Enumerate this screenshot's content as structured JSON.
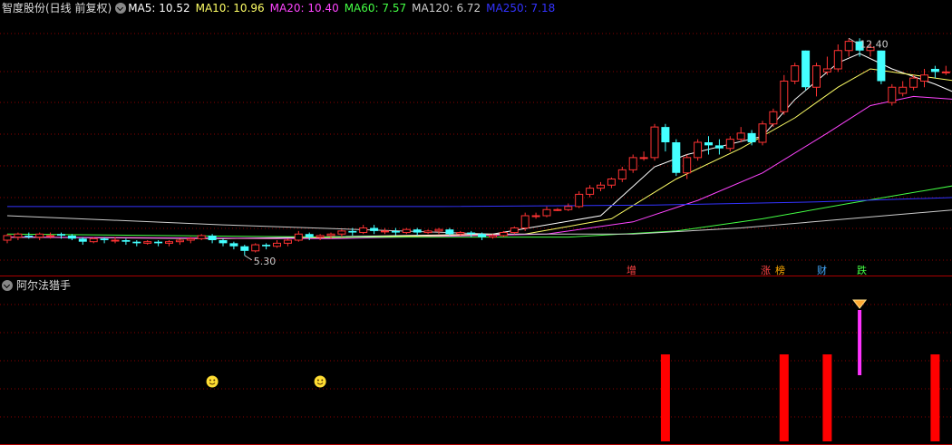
{
  "header": {
    "stock": "智度股份(日线 前复权)",
    "ma_labels": [
      {
        "text": "MA5: 10.52",
        "color": "#ffffff"
      },
      {
        "text": "MA10: 10.96",
        "color": "#ffff66"
      },
      {
        "text": "MA20: 10.40",
        "color": "#ff44ff"
      },
      {
        "text": "MA60: 7.57",
        "color": "#44ff44"
      },
      {
        "text": "MA120: 6.72",
        "color": "#cccccc"
      },
      {
        "text": "MA250: 7.18",
        "color": "#3333ff"
      }
    ]
  },
  "sub_panel": {
    "title": "阿尔法猎手"
  },
  "annotations": {
    "high_label": "12.40",
    "low_label": "5.30",
    "event_tags": [
      {
        "text": "增",
        "color": "#ff4444"
      },
      {
        "text": "涨",
        "color": "#ff4444"
      },
      {
        "text": "榜",
        "color": "#ffaa00"
      },
      {
        "text": "财",
        "color": "#44aaff"
      },
      {
        "text": "跌",
        "color": "#44ff44"
      }
    ]
  },
  "colors": {
    "up": "#ff3333",
    "down": "#44ffff",
    "grid": "#8b0000",
    "signal_bar": "#ff0000",
    "signal_magenta": "#ff33ff",
    "smiley": "#ffdd33"
  },
  "chart_data": {
    "type": "candlestick",
    "y_range": [
      5.0,
      13.0
    ],
    "candles": [
      [
        5.8,
        5.95,
        5.7,
        6.0
      ],
      [
        5.9,
        6.0,
        5.8,
        6.05
      ],
      [
        5.95,
        5.9,
        5.85,
        6.05
      ],
      [
        5.9,
        6.0,
        5.8,
        6.05
      ],
      [
        5.95,
        5.95,
        5.85,
        6.05
      ],
      [
        6.0,
        5.95,
        5.85,
        6.05
      ],
      [
        5.95,
        5.85,
        5.8,
        6.0
      ],
      [
        5.85,
        5.75,
        5.65,
        5.9
      ],
      [
        5.75,
        5.85,
        5.7,
        5.9
      ],
      [
        5.85,
        5.8,
        5.7,
        5.9
      ],
      [
        5.8,
        5.8,
        5.7,
        5.9
      ],
      [
        5.8,
        5.75,
        5.65,
        5.85
      ],
      [
        5.75,
        5.7,
        5.6,
        5.8
      ],
      [
        5.7,
        5.75,
        5.65,
        5.8
      ],
      [
        5.75,
        5.7,
        5.6,
        5.8
      ],
      [
        5.7,
        5.75,
        5.6,
        5.8
      ],
      [
        5.75,
        5.8,
        5.65,
        5.85
      ],
      [
        5.8,
        5.85,
        5.7,
        5.9
      ],
      [
        5.85,
        5.95,
        5.8,
        6.0
      ],
      [
        5.95,
        5.8,
        5.7,
        6.0
      ],
      [
        5.8,
        5.7,
        5.6,
        5.85
      ],
      [
        5.7,
        5.6,
        5.5,
        5.75
      ],
      [
        5.6,
        5.45,
        5.3,
        5.65
      ],
      [
        5.45,
        5.65,
        5.4,
        5.7
      ],
      [
        5.65,
        5.6,
        5.5,
        5.7
      ],
      [
        5.6,
        5.7,
        5.55,
        5.8
      ],
      [
        5.7,
        5.8,
        5.6,
        5.85
      ],
      [
        5.8,
        6.0,
        5.75,
        6.1
      ],
      [
        6.0,
        5.9,
        5.8,
        6.05
      ],
      [
        5.9,
        5.95,
        5.8,
        6.0
      ],
      [
        5.95,
        6.0,
        5.85,
        6.05
      ],
      [
        6.0,
        6.1,
        5.9,
        6.15
      ],
      [
        6.1,
        6.05,
        5.95,
        6.2
      ],
      [
        6.05,
        6.2,
        6.0,
        6.3
      ],
      [
        6.2,
        6.1,
        6.0,
        6.3
      ],
      [
        6.1,
        6.1,
        6.0,
        6.2
      ],
      [
        6.1,
        6.05,
        5.95,
        6.2
      ],
      [
        6.05,
        6.15,
        6.0,
        6.2
      ],
      [
        6.15,
        6.05,
        5.95,
        6.2
      ],
      [
        6.05,
        6.1,
        6.0,
        6.15
      ],
      [
        6.1,
        6.15,
        6.0,
        6.2
      ],
      [
        6.15,
        6.0,
        5.95,
        6.2
      ],
      [
        6.0,
        6.05,
        5.95,
        6.1
      ],
      [
        6.05,
        6.0,
        5.9,
        6.1
      ],
      [
        6.0,
        5.9,
        5.8,
        6.05
      ],
      [
        5.9,
        5.95,
        5.85,
        6.0
      ],
      [
        5.95,
        6.05,
        5.9,
        6.1
      ],
      [
        6.05,
        6.2,
        6.0,
        6.25
      ],
      [
        6.2,
        6.6,
        6.1,
        6.7
      ],
      [
        6.6,
        6.6,
        6.5,
        6.7
      ],
      [
        6.6,
        6.8,
        6.55,
        6.9
      ],
      [
        6.8,
        6.8,
        6.75,
        6.85
      ],
      [
        6.8,
        6.9,
        6.75,
        7.0
      ],
      [
        6.9,
        7.3,
        6.85,
        7.4
      ],
      [
        7.3,
        7.5,
        7.2,
        7.6
      ],
      [
        7.5,
        7.6,
        7.4,
        7.7
      ],
      [
        7.6,
        7.8,
        7.5,
        7.85
      ],
      [
        7.8,
        8.1,
        7.7,
        8.2
      ],
      [
        8.1,
        8.5,
        8.0,
        8.6
      ],
      [
        8.5,
        8.5,
        8.4,
        8.7
      ],
      [
        8.5,
        9.5,
        8.4,
        9.6
      ],
      [
        9.5,
        9.0,
        8.7,
        9.6
      ],
      [
        9.0,
        8.0,
        7.9,
        9.1
      ],
      [
        8.0,
        8.5,
        7.8,
        8.6
      ],
      [
        8.5,
        9.0,
        8.4,
        9.1
      ],
      [
        9.0,
        8.9,
        8.6,
        9.2
      ],
      [
        8.9,
        8.8,
        8.6,
        9.1
      ],
      [
        8.8,
        9.1,
        8.7,
        9.2
      ],
      [
        9.1,
        9.3,
        9.0,
        9.5
      ],
      [
        9.3,
        9.0,
        8.9,
        9.4
      ],
      [
        9.0,
        9.6,
        8.9,
        9.7
      ],
      [
        9.6,
        10.0,
        9.5,
        10.1
      ],
      [
        10.0,
        11.0,
        9.9,
        11.2
      ],
      [
        11.0,
        11.5,
        10.9,
        11.6
      ],
      [
        12.0,
        10.8,
        10.7,
        12.0
      ],
      [
        10.8,
        11.5,
        10.5,
        11.6
      ],
      [
        11.3,
        11.4,
        11.2,
        11.8
      ],
      [
        11.4,
        12.0,
        11.3,
        12.2
      ],
      [
        12.0,
        12.3,
        11.8,
        12.4
      ],
      [
        12.3,
        12.0,
        11.8,
        12.4
      ],
      [
        12.0,
        12.1,
        11.8,
        12.3
      ],
      [
        12.0,
        11.0,
        10.9,
        12.0
      ],
      [
        10.3,
        10.8,
        10.2,
        10.9
      ],
      [
        10.6,
        10.8,
        10.5,
        11.0
      ],
      [
        10.8,
        11.1,
        10.7,
        11.2
      ],
      [
        11.0,
        11.2,
        10.8,
        11.4
      ],
      [
        11.4,
        11.3,
        11.1,
        11.5
      ],
      [
        11.3,
        11.3,
        11.2,
        11.5
      ],
      [
        11.3,
        11.2,
        11.0,
        11.4
      ]
    ],
    "ma_series": [
      {
        "name": "MA5",
        "color": "#ffffff",
        "points": [
          [
            0,
            5.9
          ],
          [
            20,
            5.85
          ],
          [
            45,
            6.0
          ],
          [
            55,
            6.6
          ],
          [
            60,
            8.2
          ],
          [
            63,
            8.6
          ],
          [
            70,
            9.2
          ],
          [
            73,
            10.4
          ],
          [
            77,
            11.6
          ],
          [
            79,
            11.9
          ],
          [
            82,
            11.4
          ],
          [
            86,
            10.9
          ],
          [
            88,
            10.6
          ]
        ]
      },
      {
        "name": "MA10",
        "color": "#ffff66",
        "points": [
          [
            0,
            5.9
          ],
          [
            25,
            5.85
          ],
          [
            48,
            6.0
          ],
          [
            56,
            6.5
          ],
          [
            62,
            7.8
          ],
          [
            68,
            8.8
          ],
          [
            73,
            9.8
          ],
          [
            77,
            10.8
          ],
          [
            80,
            11.4
          ],
          [
            84,
            11.2
          ],
          [
            88,
            11.0
          ]
        ]
      },
      {
        "name": "MA20",
        "color": "#ff44ff",
        "points": [
          [
            0,
            5.9
          ],
          [
            30,
            5.85
          ],
          [
            50,
            6.0
          ],
          [
            58,
            6.4
          ],
          [
            64,
            7.1
          ],
          [
            70,
            8.0
          ],
          [
            76,
            9.3
          ],
          [
            80,
            10.2
          ],
          [
            84,
            10.5
          ],
          [
            88,
            10.4
          ]
        ]
      },
      {
        "name": "MA60",
        "color": "#44ff44",
        "points": [
          [
            0,
            6.0
          ],
          [
            30,
            5.9
          ],
          [
            52,
            5.9
          ],
          [
            62,
            6.1
          ],
          [
            70,
            6.5
          ],
          [
            78,
            7.0
          ],
          [
            88,
            7.6
          ]
        ]
      },
      {
        "name": "MA120",
        "color": "#cccccc",
        "points": [
          [
            0,
            6.6
          ],
          [
            20,
            6.3
          ],
          [
            45,
            6.0
          ],
          [
            58,
            6.0
          ],
          [
            68,
            6.2
          ],
          [
            78,
            6.5
          ],
          [
            88,
            6.8
          ]
        ]
      },
      {
        "name": "MA250",
        "color": "#3333ff",
        "points": [
          [
            0,
            6.9
          ],
          [
            40,
            6.9
          ],
          [
            60,
            6.95
          ],
          [
            75,
            7.05
          ],
          [
            88,
            7.2
          ]
        ]
      }
    ],
    "subchart": {
      "red_bars": [
        61,
        72,
        76,
        86
      ],
      "magenta_bar": 79,
      "smileys": [
        19,
        29
      ]
    }
  }
}
